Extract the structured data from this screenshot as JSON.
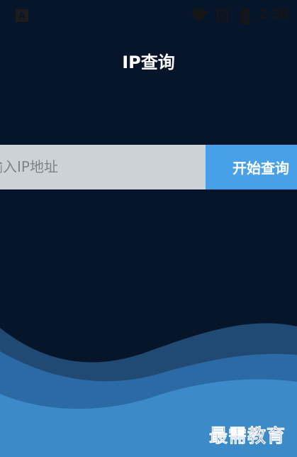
{
  "status_bar": {
    "app_badge": "A",
    "time": "2:56"
  },
  "header": {
    "title": "IP查询"
  },
  "search": {
    "placeholder": "输入IP地址",
    "button_label": "开始查询"
  },
  "watermark": {
    "text": "最需教育"
  },
  "colors": {
    "background": "#07152a",
    "input_bg": "#ccd2d6",
    "button_bg": "#48a0e8",
    "wave_dark": "#204a74",
    "wave_mid": "#2c6aa6",
    "wave_light": "#3d8ac8",
    "watermark": "#1b2fa8"
  }
}
